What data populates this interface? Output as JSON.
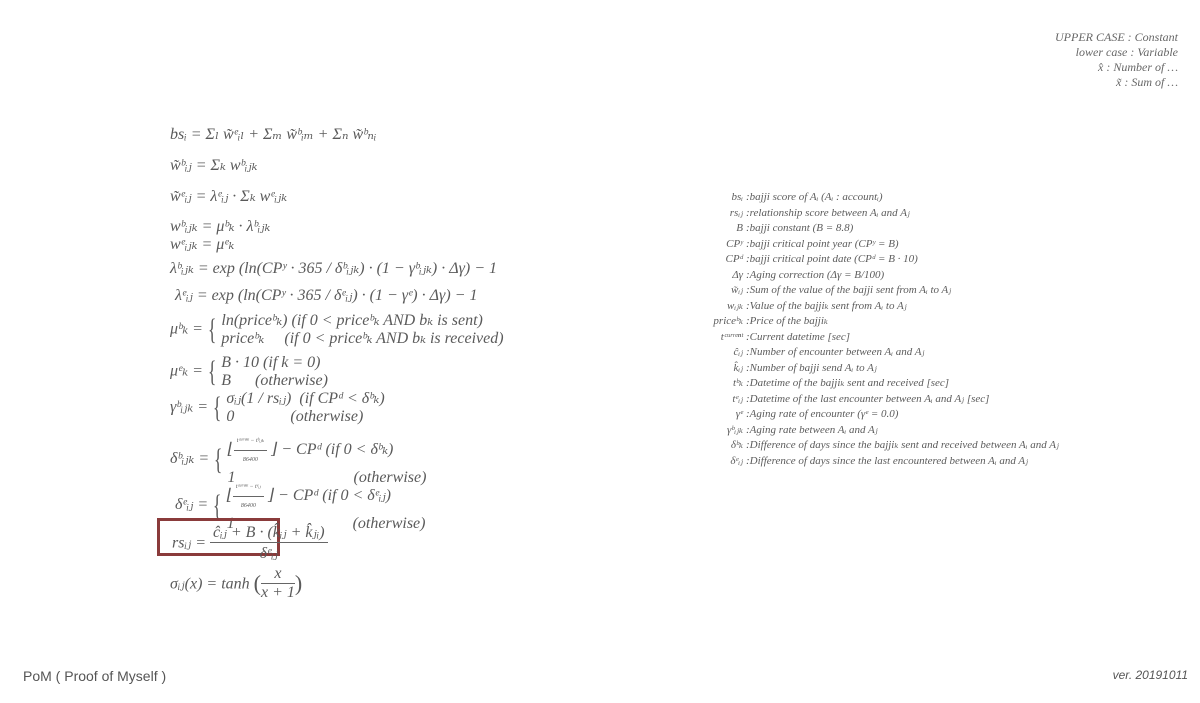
{
  "legend": [
    {
      "label": "UPPER CASE : Constant"
    },
    {
      "label": "lower case : Variable"
    },
    {
      "label": "x̂ : Number of …"
    },
    {
      "label": "x̃ : Sum of …"
    }
  ],
  "formulas": {
    "bs": "bsᵢ = Σₗ w̃ᵉᵢₗ + Σₘ w̃ᵇᵢₘ + Σₙ w̃ᵇₙᵢ",
    "w_b_sum": "w̃ᵇᵢⱼ = Σₖ wᵇᵢⱼₖ",
    "w_e_sum": "w̃ᵉᵢⱼ = λᵉᵢⱼ · Σₖ wᵉᵢⱼₖ",
    "w_b": "wᵇᵢⱼₖ = μᵇₖ · λᵇᵢⱼₖ",
    "w_e": "wᵉᵢⱼₖ = μᵉₖ",
    "lambda_b": "λᵇᵢⱼₖ = exp (ln(CPʸ · 365 / δᵇᵢⱼₖ) · (1 − γᵇᵢⱼₖ) · Δγ) − 1",
    "lambda_e": "λᵉᵢⱼ = exp (ln(CPʸ · 365 / δᵉᵢⱼ) · (1 − γᵉ) · Δγ) − 1",
    "mu_b_lhs": "μᵇₖ =",
    "mu_b_case1": "ln(priceᵇₖ) (if 0 < priceᵇₖ AND bₖ is sent)",
    "mu_b_case2": "priceᵇₖ     (if 0 < priceᵇₖ AND bₖ is received)",
    "mu_e_lhs": "μᵉₖ =",
    "mu_e_case1": "B · 10 (if k = 0)",
    "mu_e_case2": "B      (otherwise)",
    "gamma_lhs": "γᵇᵢⱼₖ =",
    "gamma_case1": "σᵢⱼ(1 / rsᵢⱼ)  (if CPᵈ < δᵇₖ)",
    "gamma_case2": "0              (otherwise)",
    "delta_b_lhs": "δᵇᵢⱼₖ =",
    "delta_b_num": "tᶜᵘʳʳᵉⁿᵗ − tᵇᵢⱼₖ",
    "delta_b_den": "86400",
    "delta_b_tail": "⌋ − CPᵈ (if 0 < δᵇₖ)",
    "delta_b_case2": "1",
    "delta_b_otherwise": "(otherwise)",
    "delta_e_lhs": "δᵉᵢⱼ =",
    "delta_e_num": "tᶜᵘʳʳᵉⁿᵗ − tᵉᵢⱼ",
    "delta_e_den": "86400",
    "delta_e_tail": "⌋ − CPᵈ (if 0 < δᵉᵢⱼ)",
    "delta_e_case2": "1",
    "delta_e_otherwise": "(otherwise)",
    "rs_lhs": "rsᵢⱼ =",
    "rs_num": "ĉᵢⱼ + B · (k̂ᵢⱼ + k̂ⱼᵢ)",
    "rs_den": "δᵉᵢⱼ",
    "sigma_lhs": "σᵢⱼ(x) = tanh",
    "sigma_num": "x",
    "sigma_den": "x + 1"
  },
  "definitions": [
    {
      "symbol": "bsᵢ",
      "text": "bajji score of Aᵢ (Aᵢ : accountᵢ)"
    },
    {
      "symbol": "rsᵢⱼ",
      "text": "relationship score between Aᵢ and Aⱼ"
    },
    {
      "symbol": "B",
      "text": "bajji constant (B = 8.8)"
    },
    {
      "symbol": "CPʸ",
      "text": "bajji critical point year (CPʸ = B)"
    },
    {
      "symbol": "CPᵈ",
      "text": "bajji critical point date (CPᵈ = B · 10)"
    },
    {
      "symbol": "Δγ",
      "text": "Aging correction (Δγ = B/100)"
    },
    {
      "symbol": "w̃ᵢⱼ",
      "text": "Sum of the value of the bajji sent from Aᵢ to Aⱼ"
    },
    {
      "symbol": "wᵢⱼₖ",
      "text": "Value of the bajjiₖ sent from Aᵢ to Aⱼ"
    },
    {
      "symbol": "priceᵇₖ",
      "text": "Price of the bajjiₖ"
    },
    {
      "symbol": "tᶜᵘʳʳᵉⁿᵗ",
      "text": "Current datetime [sec]"
    },
    {
      "symbol": "ĉᵢⱼ",
      "text": "Number of encounter between Aᵢ and Aⱼ"
    },
    {
      "symbol": "k̂ᵢⱼ",
      "text": "Number of bajji send Aᵢ to Aⱼ"
    },
    {
      "symbol": "tᵇₖ",
      "text": "Datetime of the bajjiₖ sent and received [sec]"
    },
    {
      "symbol": "tᵉᵢⱼ",
      "text": "Datetime of the last encounter between Aᵢ and Aⱼ [sec]"
    },
    {
      "symbol": "γᵉ",
      "text": "Aging rate of encounter (γᵉ = 0.0)"
    },
    {
      "symbol": "γᵇᵢⱼₖ",
      "text": "Aging rate between Aᵢ and Aⱼ"
    },
    {
      "symbol": "δᵇₖ",
      "text": "Difference of days since the bajjiₖ sent and received between Aᵢ and Aⱼ"
    },
    {
      "symbol": "δᵉᵢⱼ",
      "text": "Difference of days since the last encountered between Aᵢ and Aⱼ"
    }
  ],
  "footer": {
    "title": "PoM  ( Proof of Myself )",
    "version": "ver. 20191011"
  },
  "colors": {
    "highlight_border": "#8a3b3b",
    "text": "#5c5c5c"
  }
}
